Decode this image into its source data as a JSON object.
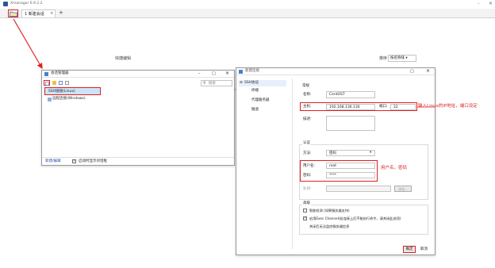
{
  "app": {
    "title": "Xmanager 6.9.2.2"
  },
  "window_controls": {
    "minimize": "–",
    "maximize": "□",
    "close": "×"
  },
  "tabs": [
    {
      "label": "1 新建会话",
      "close": "×"
    }
  ],
  "tab_add": "+",
  "sort": {
    "label": "排序",
    "value": "按名称排 ▾"
  },
  "back_panel": {
    "label": "快捷编辑"
  },
  "session_manager": {
    "title": "会话管理器",
    "search_placeholder": "搜索",
    "items": [
      "SSH链接(Linux)",
      "远程连接(Windows)"
    ],
    "footer_button": "新建/编辑",
    "footer_checkbox": "启动时显示对话框"
  },
  "new_session": {
    "title": "新建连接",
    "tree": [
      "SSH协议",
      "终端",
      "代理服务器",
      "隧道"
    ],
    "group_general": "常规",
    "name_label": "名称:",
    "name_value": "CentOS7",
    "host_label": "主机:",
    "host_value": "192.168.136.130",
    "port_label": "端口:",
    "port_value": "22",
    "desc_label": "描述:",
    "group_auth": "认证",
    "method_label": "方法:",
    "method_value": "密码",
    "user_label": "用户名:",
    "user_value": "root",
    "pass_label": "密码:",
    "pass_value": "****",
    "key_label": "私钥:",
    "key_button": "浏览...",
    "group_advanced": "高级",
    "adv_option1": "智能检测 (如果服务器支持)",
    "adv_option2": "启用Exec Channel(若连接上后不能执行命令，请关闭此选项)",
    "adv_option3": "关闭后无法监控服务器信息",
    "ok_button": "确定",
    "cancel_button": "取消"
  },
  "annotations": {
    "host_note": "输入Linux的IP地址，端口设定",
    "user_note": "用户名，密码"
  }
}
